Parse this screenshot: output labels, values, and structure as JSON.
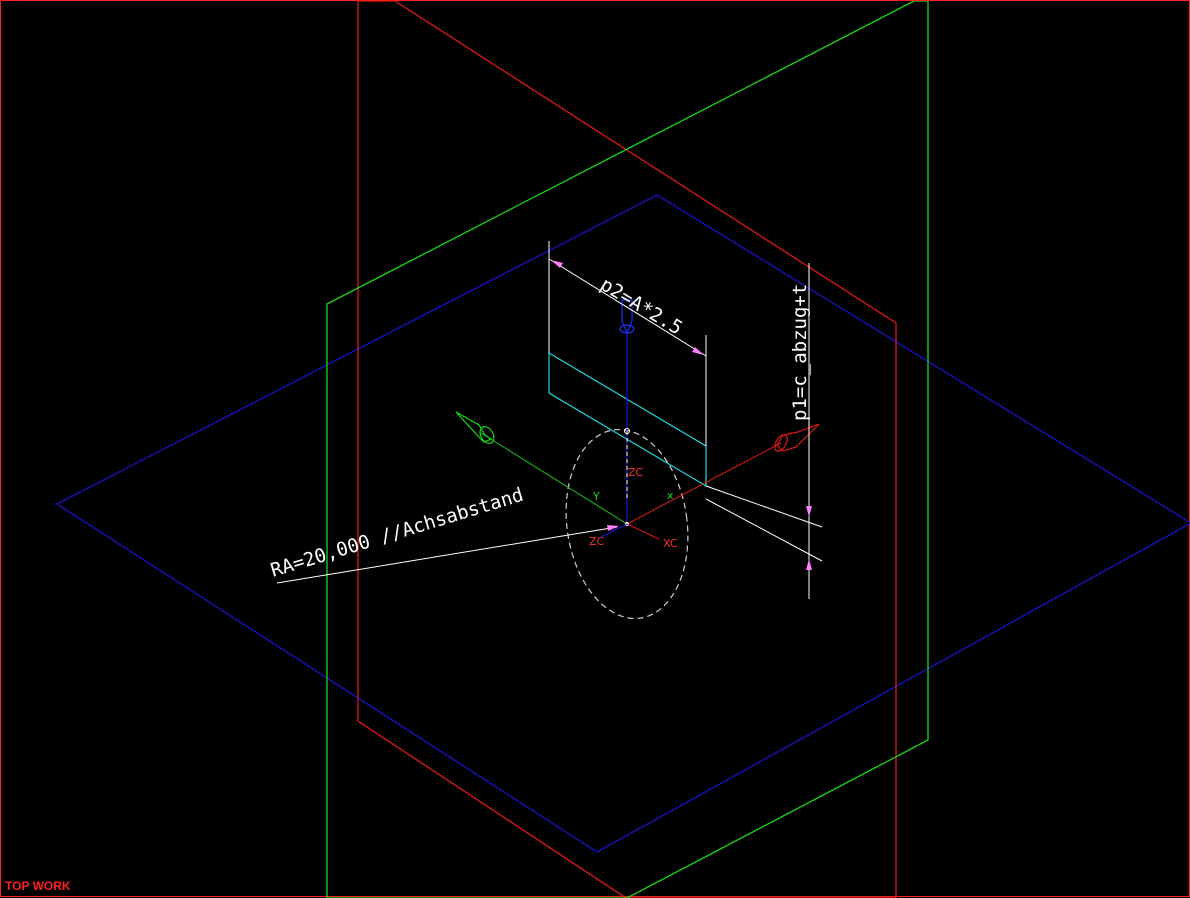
{
  "viewport": {
    "view_label": "TOP WORK"
  },
  "annotations": {
    "dim_width": "p2=A*2.5",
    "dim_height": "p1=c_abzug+t",
    "leader_note": "RA=20,000 //Achsabstand"
  },
  "axes": {
    "wcs": {
      "x": "x",
      "y": "Y",
      "z": "ZC"
    },
    "csys": {
      "x": "XC",
      "z": "ZC"
    }
  },
  "colors": {
    "background": "#000000",
    "xy_plane": "#1515c8",
    "yz_plane": "#e01818",
    "xz_plane": "#18d818",
    "sketch_rect": "#20d8e0",
    "dimension": "#ffffff",
    "dimension_arrow": "#ff80ff",
    "border": "#ff2020"
  }
}
